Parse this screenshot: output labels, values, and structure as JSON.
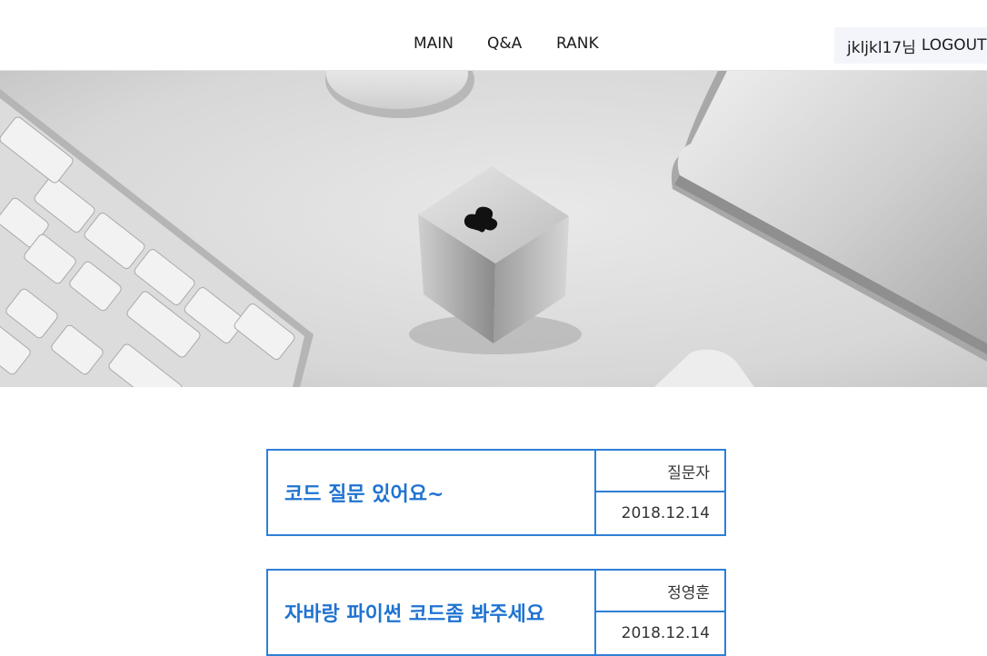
{
  "nav": {
    "items": [
      {
        "label": "MAIN"
      },
      {
        "label": "Q&A"
      },
      {
        "label": "RANK"
      }
    ]
  },
  "user": {
    "greeting": "jkljkl17님",
    "logout_label": "LOGOUT"
  },
  "hero": {
    "icon": "hero-desk-image"
  },
  "posts": [
    {
      "title": "코드 질문 있어요~",
      "author": "질문자",
      "date": "2018.12.14"
    },
    {
      "title": "자바랑 파이썬 코드좀 봐주세요",
      "author": "정영훈",
      "date": "2018.12.14"
    }
  ],
  "colors": {
    "accent": "#2f7fd6",
    "title": "#1f73d1",
    "user_box_bg": "#f4f5fb"
  }
}
